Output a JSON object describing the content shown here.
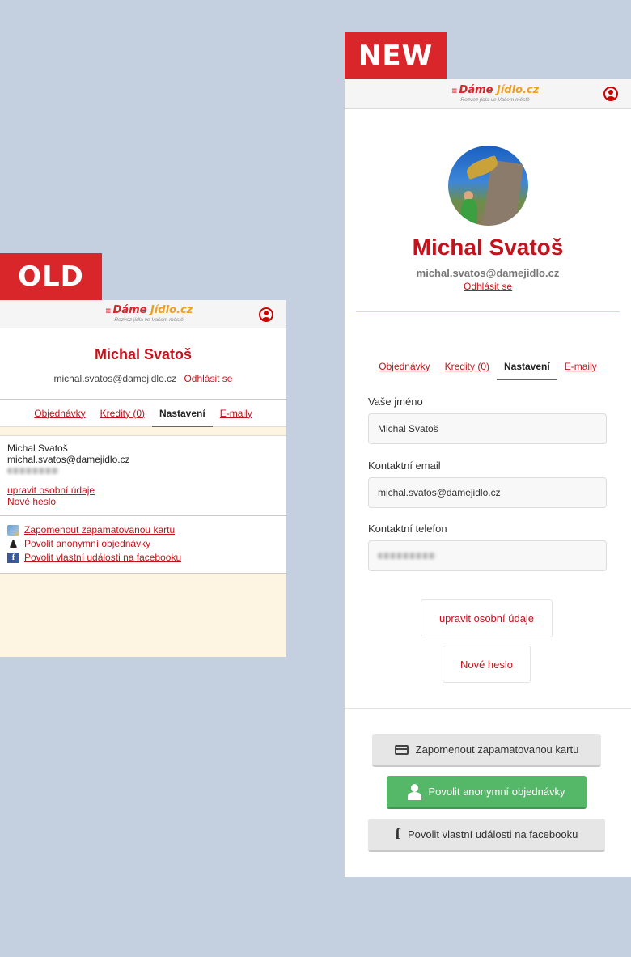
{
  "tags": {
    "old": "OLD",
    "new": "NEW"
  },
  "logo": {
    "name_a": "Dáme",
    "name_b": "Jídlo",
    "tld": ".cz",
    "tagline": "Rozvoz jídla ve Vašem městě"
  },
  "old": {
    "name": "Michal Svatoš",
    "email": "michal.svatos@damejidlo.cz",
    "logout": "Odhlásit se",
    "tabs": [
      "Objednávky",
      "Kredity (0)",
      "Nastavení",
      "E-maily"
    ],
    "info_name": "Michal Svatoš",
    "info_email": "michal.svatos@damejidlo.cz",
    "edit_link": "upravit osobní údaje",
    "password_link": "Nové heslo",
    "links": [
      "Zapomenout zapamatovanou kartu",
      "Povolit anonymní objednávky",
      "Povolit vlastní události na facebooku"
    ]
  },
  "new": {
    "name": "Michal Svatoš",
    "email": "michal.svatos@damejidlo.cz",
    "logout": "Odhlásit se",
    "tabs": [
      "Objednávky",
      "Kredity (0)",
      "Nastavení",
      "E-maily"
    ],
    "fields": [
      {
        "label": "Vaše jméno",
        "value": "Michal Svatoš"
      },
      {
        "label": "Kontaktní email",
        "value": "michal.svatos@damejidlo.cz"
      },
      {
        "label": "Kontaktní telefon",
        "value": ""
      }
    ],
    "edit_button": "upravit osobní údaje",
    "password_button": "Nové heslo",
    "forget_card": "Zapomenout zapamatovanou kartu",
    "anon_orders": "Povolit anonymní objednávky",
    "facebook": "Povolit vlastní události na facebooku"
  },
  "colors": {
    "brand_red": "#c4131c",
    "tag_red": "#d8262a",
    "green": "#55b868",
    "bg": "#c4cfdf"
  }
}
